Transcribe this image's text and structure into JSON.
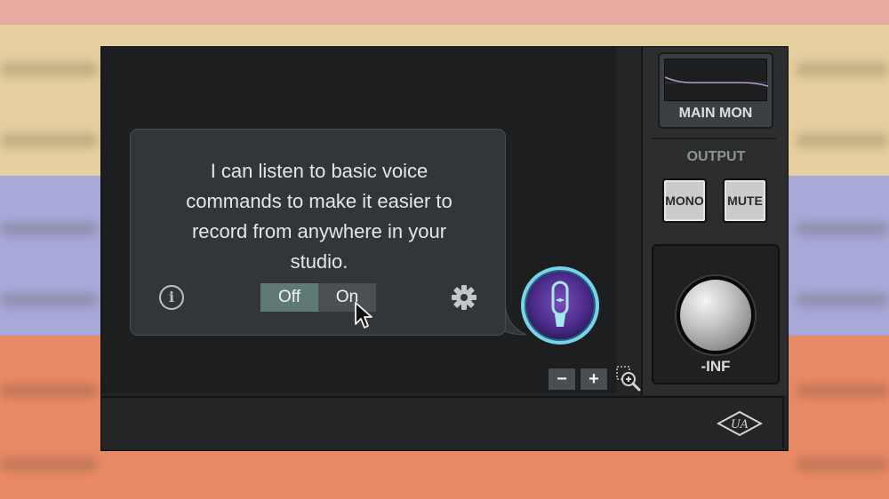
{
  "bubble": {
    "lines": [
      "I can listen to basic voice",
      "commands to make it easier to",
      "record from anywhere in your",
      "studio."
    ],
    "toggle": {
      "off_label": "Off",
      "on_label": "On",
      "selected": "Off"
    }
  },
  "zoom": {
    "minus_label": "−",
    "plus_label": "+"
  },
  "right_panel": {
    "main_mon_label": "MAIN MON",
    "output_label": "OUTPUT",
    "mono_label": "MONO",
    "mute_label": "MUTE",
    "knob_value": "-INF"
  },
  "icons": {
    "info": "info-icon",
    "gear": "gear-icon",
    "mic": "microphone-icon",
    "zoom_fit": "zoom-fit-icon",
    "logo": "universal-audio-logo"
  },
  "colors": {
    "toggle_selected": "#5f7a75",
    "orb_ring": "#76d4e6",
    "orb_core": "#6c3a9e"
  }
}
